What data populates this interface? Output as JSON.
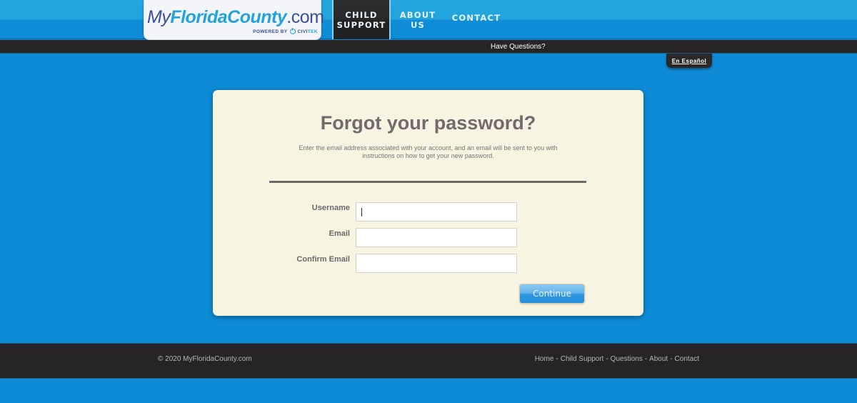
{
  "header": {
    "logo": {
      "my": "My",
      "florida_county": "FloridaCounty",
      "dotcom": ".com",
      "powered_by": "POWERED BY",
      "civi": "CIVI",
      "tek": "TEK"
    },
    "nav": [
      {
        "line1": "Child",
        "line2": "Support",
        "active": true
      },
      {
        "line1": "About",
        "line2": "Us",
        "active": false
      },
      {
        "line1": "Contact",
        "line2": "",
        "active": false
      }
    ]
  },
  "questions_bar": {
    "text": "Have Questions?",
    "language_link": "En Español"
  },
  "form": {
    "title": "Forgot your password?",
    "description": "Enter the email address associated with your account, and an email will be sent to you with instructions on how to get your new password.",
    "fields": [
      {
        "label": "Username",
        "value": "",
        "placeholder": "",
        "focused": true
      },
      {
        "label": "Email",
        "value": "",
        "placeholder": ""
      },
      {
        "label": "Confirm Email",
        "value": "",
        "placeholder": ""
      }
    ],
    "submit_label": "Continue"
  },
  "footer": {
    "copyright": "© 2020 MyFloridaCounty.com",
    "links": [
      "Home",
      "Child Support",
      "Questions",
      "About",
      "Contact"
    ],
    "separator": "-"
  },
  "colors": {
    "page_bg": "#0e8bd6",
    "dark_bar": "#262425",
    "card_bg": "#f8f4e2",
    "text_gray": "#726a6d",
    "brand_blue": "#23a3dc",
    "brand_navy": "#3b4e9a"
  }
}
